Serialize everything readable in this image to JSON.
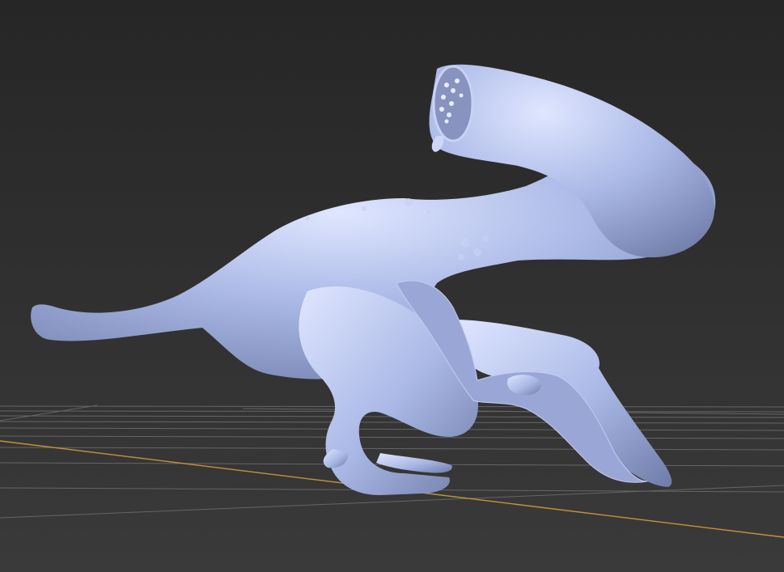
{
  "viewport": {
    "background_top": "#262626",
    "background_bottom": "#3a3a3a",
    "grid_color": "#6e6e6e",
    "x_axis_color": "#c8923a"
  },
  "model": {
    "material_color": "#aab8e6",
    "shadow_color": "#6f7ca8",
    "highlight_color": "#dfe6ff"
  }
}
